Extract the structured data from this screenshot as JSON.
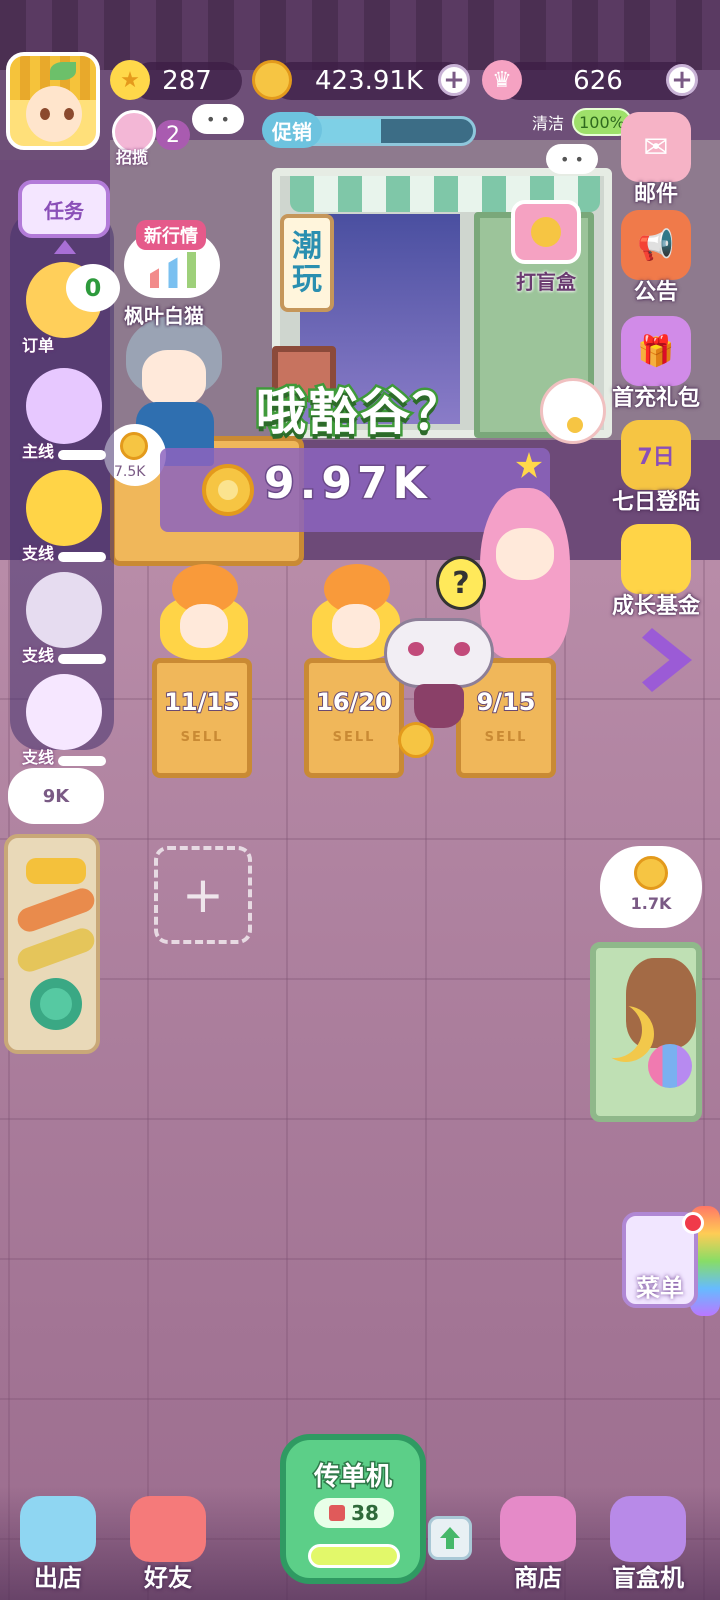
{
  "hud": {
    "stars": "287",
    "coins": "423.91K",
    "crowns": "626",
    "recruit_count": "2",
    "recruit_label": "招揽",
    "promo_label": "促销",
    "promo_progress": 0.55,
    "clean_label": "清洁",
    "clean_value": "100%"
  },
  "left_menu": {
    "task_label": "任务",
    "order_count": "0",
    "order_tag": "订单",
    "quests": [
      {
        "tag": "主线",
        "icon": "diy-icon"
      },
      {
        "tag": "支线",
        "icon": "cat-doll-icon"
      },
      {
        "tag": "支线",
        "icon": "refresh-icon"
      },
      {
        "tag": "支线",
        "icon": "hand-gift-icon"
      }
    ],
    "bubble_value": "9K"
  },
  "right_menu": {
    "mail": "邮件",
    "notice": "公告",
    "first_charge": "首充礼包",
    "seven_day": "七日登陆",
    "seven_day_icon": "7日",
    "growth_fund": "成长基金",
    "menu": "菜单",
    "coin_bubble": "1.7K"
  },
  "shop": {
    "sign": [
      "潮",
      "玩"
    ],
    "blind_box": "打盲盒",
    "title": "哦豁谷？",
    "income": "9.97K",
    "market_tag": "新行情",
    "market_name": "枫叶白猫",
    "counter_bubble": "7.5K"
  },
  "stalls": [
    {
      "count": "11/15",
      "sell": "SELL"
    },
    {
      "count": "16/20",
      "sell": "SELL"
    },
    {
      "count": "9/15",
      "sell": "SELL"
    }
  ],
  "bottom_nav": {
    "leave": "出店",
    "friends": "好友",
    "flyer": "传单机",
    "flyer_count": "38",
    "shop": "商店",
    "blind_box_machine": "盲盒机"
  },
  "colors": {
    "coin": "#f6c543",
    "accent_purple": "#9b5bd6",
    "green_button": "#5ccf88"
  }
}
